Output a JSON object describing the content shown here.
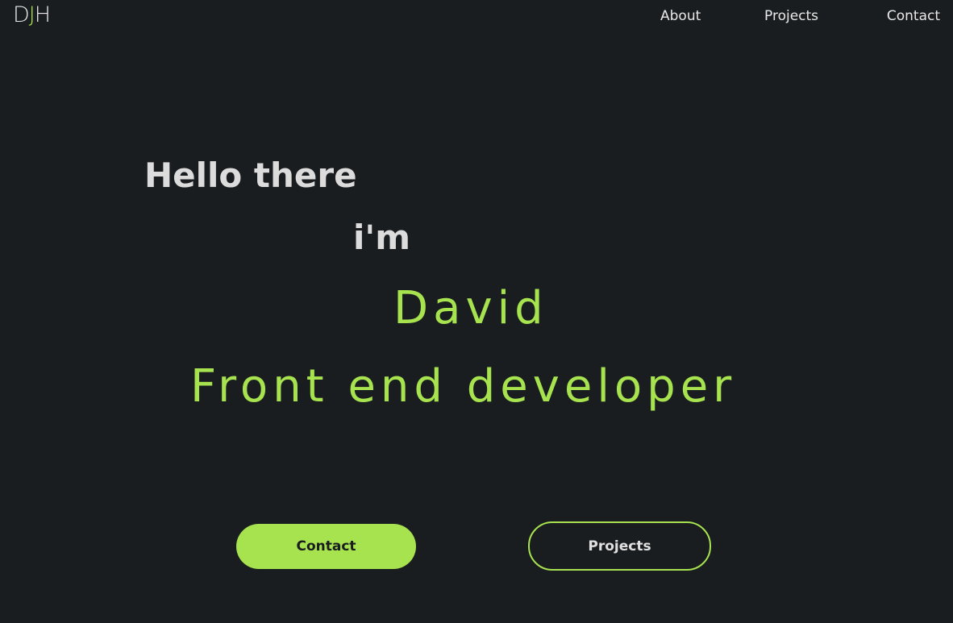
{
  "logo": {
    "part1": "D",
    "part2": "J",
    "part3": "H"
  },
  "nav": {
    "about": "About",
    "projects": "Projects",
    "contact": "Contact"
  },
  "hero": {
    "greeting": "Hello there",
    "intro": "i'm",
    "name": "David",
    "role": "Front end developer"
  },
  "buttons": {
    "contact": "Contact",
    "projects": "Projects"
  },
  "colors": {
    "background": "#1a1d20",
    "accent": "#a7e24f",
    "text": "#dcdcdc"
  }
}
